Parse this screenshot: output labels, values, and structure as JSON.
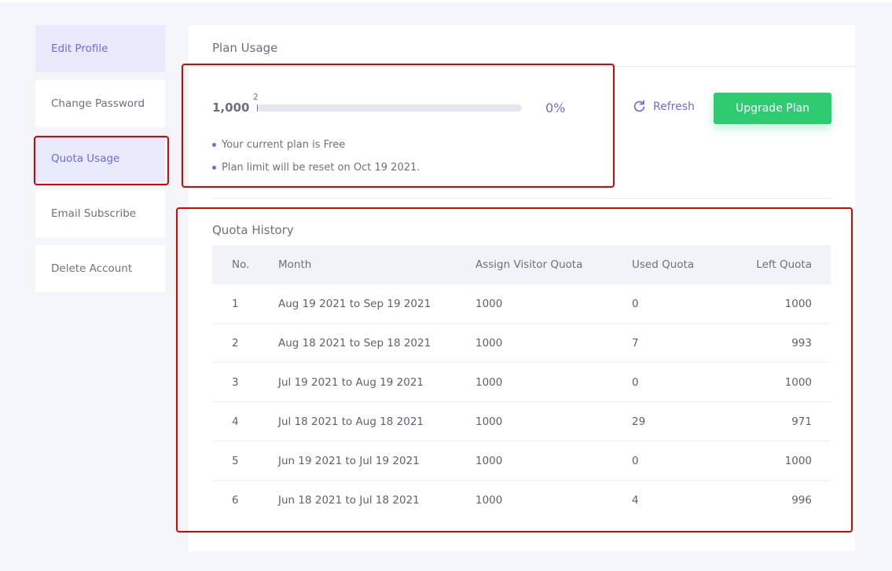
{
  "sidebar": {
    "items": [
      {
        "label": "Edit Profile"
      },
      {
        "label": "Change Password"
      },
      {
        "label": "Quota Usage"
      },
      {
        "label": "Email Subscribe"
      },
      {
        "label": "Delete Account"
      }
    ],
    "active": "Quota Usage"
  },
  "plan_usage": {
    "title": "Plan Usage",
    "total": "1,000",
    "used": "2",
    "percent_label": "0%",
    "progress_fraction": 0.0,
    "notes": [
      "Your current plan is Free",
      "Plan limit will be reset on Oct 19 2021."
    ],
    "refresh_label": "Refresh",
    "refresh_icon": "refresh-icon",
    "upgrade_label": "Upgrade Plan"
  },
  "quota_history": {
    "title": "Quota History",
    "columns": [
      "No.",
      "Month",
      "Assign Visitor Quota",
      "Used Quota",
      "Left Quota"
    ],
    "rows": [
      [
        "1",
        "Aug 19 2021 to Sep 19 2021",
        "1000",
        "0",
        "1000"
      ],
      [
        "2",
        "Aug 18 2021 to Sep 18 2021",
        "1000",
        "7",
        "993"
      ],
      [
        "3",
        "Jul 19 2021 to Aug 19 2021",
        "1000",
        "0",
        "1000"
      ],
      [
        "4",
        "Jul 18 2021 to Aug 18 2021",
        "1000",
        "29",
        "971"
      ],
      [
        "5",
        "Jun 19 2021 to Jul 19 2021",
        "1000",
        "0",
        "1000"
      ],
      [
        "6",
        "Jun 18 2021 to Jul 18 2021",
        "1000",
        "4",
        "996"
      ]
    ]
  },
  "colors": {
    "accent": "#6a6de3",
    "upgrade_button": "#2ecb71",
    "highlight_box": "#e00000",
    "page_background": "#f4f5f8"
  }
}
